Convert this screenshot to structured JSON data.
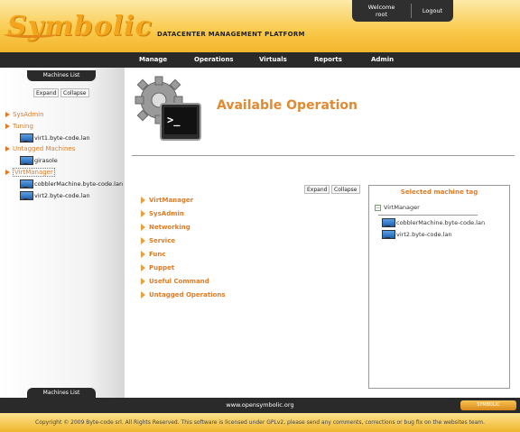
{
  "header": {
    "logo_text": "Symbolic",
    "tagline": "DATACENTER MANAGEMENT PLATFORM",
    "welcome": "Welcome",
    "username": "root",
    "logout_label": "Logout"
  },
  "nav": {
    "items": [
      {
        "label": "Manage"
      },
      {
        "label": "Operations"
      },
      {
        "label": "Virtuals"
      },
      {
        "label": "Reports"
      },
      {
        "label": "Admin"
      }
    ]
  },
  "sidebar": {
    "tab_label": "Machines List",
    "expand_label": "Expand",
    "collapse_label": "Collapse",
    "tree": [
      {
        "type": "group",
        "label": "SysAdmin"
      },
      {
        "type": "group",
        "label": "Tuning"
      },
      {
        "type": "leaf",
        "label": "virt1.byte-code.lan"
      },
      {
        "type": "group",
        "label": "Untagged Machines"
      },
      {
        "type": "leaf",
        "label": "girasole"
      },
      {
        "type": "group",
        "label": "VirtManager",
        "selected": true
      },
      {
        "type": "leaf",
        "label": "cobblerMachine.byte-code.lan"
      },
      {
        "type": "leaf",
        "label": "virt2.byte-code.lan"
      }
    ],
    "bottom_tab_label": "Machines List"
  },
  "main": {
    "title": "Available Operation",
    "expand_label": "Expand",
    "collapse_label": "Collapse",
    "operations": [
      {
        "label": "VirtManager"
      },
      {
        "label": "SysAdmin"
      },
      {
        "label": "Networking"
      },
      {
        "label": "Service"
      },
      {
        "label": "Func"
      },
      {
        "label": "Puppet"
      },
      {
        "label": "Useful Command"
      },
      {
        "label": "Untagged Operations"
      }
    ],
    "tag_panel": {
      "title": "Selected machine tag",
      "group_label": "VirtManager",
      "items": [
        {
          "label": "cobblerMachine.byte-code.lan"
        },
        {
          "label": "virt2.byte-code.lan"
        }
      ]
    }
  },
  "footer": {
    "link": "www.opensymbolic.org",
    "badge": "SYMBOLIC",
    "copyright": "Copyright © 2009 Byte-code srl. All Rights Reserved. This software is licensed under GPLv2, please send any comments, corrections or bug fix on the websites team."
  },
  "colors": {
    "accent": "#e07b24",
    "header_gold": "#f9c94a",
    "bar_dark": "#2a2a2a"
  }
}
